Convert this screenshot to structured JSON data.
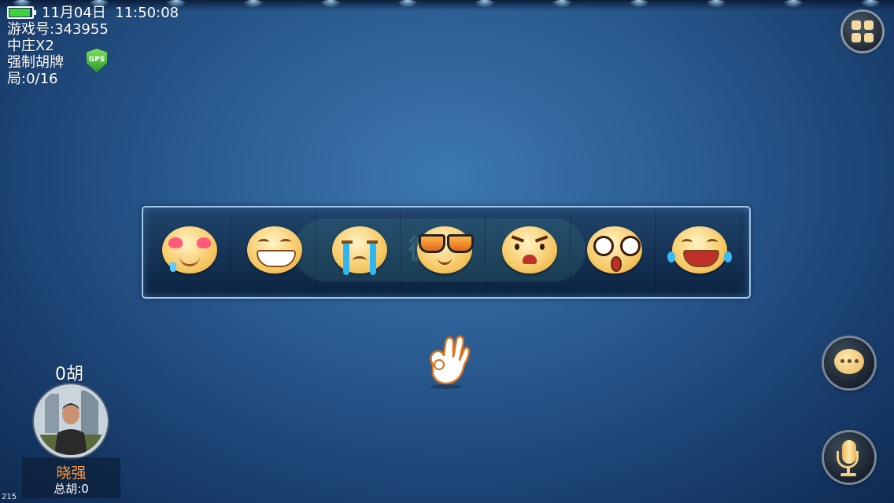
{
  "status": {
    "date": "11月04日",
    "time": "11:50:08",
    "battery_level": 0.88
  },
  "room": {
    "game_id": "游戏号:343955",
    "banker_rule": "中庄X2",
    "win_rule": "强制胡牌",
    "round": "局:0/16",
    "gps_label": "GPS"
  },
  "emoji_panel": {
    "watermark": "微信",
    "items": [
      {
        "icon": "heart-eyes-emoji-icon"
      },
      {
        "icon": "grin-emoji-icon"
      },
      {
        "icon": "crying-emoji-icon"
      },
      {
        "icon": "sunglasses-emoji-icon"
      },
      {
        "icon": "angry-emoji-icon"
      },
      {
        "icon": "shocked-emoji-icon"
      },
      {
        "icon": "laughing-tears-emoji-icon"
      }
    ]
  },
  "player": {
    "score": "0胡",
    "name": "晓强",
    "total": "总胡:0"
  },
  "corner_label": "215",
  "colors": {
    "background": "#2a5b91",
    "name_accent": "#ff9a3c",
    "button_gold": "#f3d9a0"
  }
}
